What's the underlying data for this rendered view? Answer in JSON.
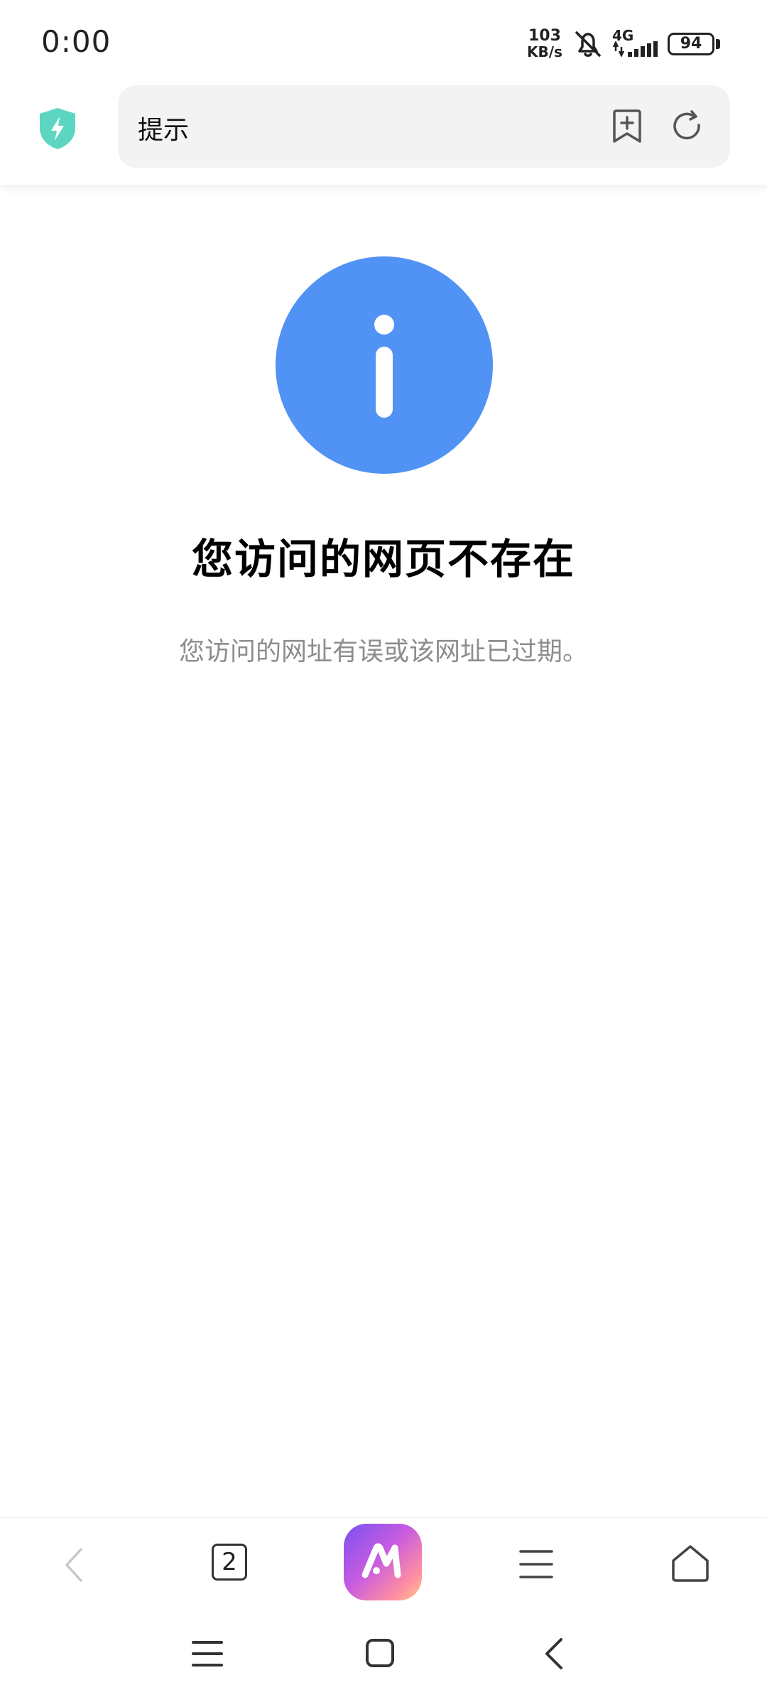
{
  "status_bar": {
    "time": "0:00",
    "speed_value": "103",
    "speed_unit": "KB/s",
    "network_type": "4G",
    "battery_level": "94",
    "icons": [
      "mute-bell-icon",
      "signal-icon",
      "battery-icon"
    ]
  },
  "toolbar": {
    "page_title": "提示",
    "icons": [
      "shield-icon",
      "bookmark-add-icon",
      "reload-icon"
    ]
  },
  "error_page": {
    "icon": "info-icon",
    "title": "您访问的网页不存在",
    "description": "您访问的网址有误或该网址已过期。"
  },
  "bottom_bar": {
    "tab_count": "2",
    "icons": [
      "back-icon",
      "tabs-icon",
      "ai-assistant-icon",
      "menu-icon",
      "home-icon"
    ]
  },
  "system_nav": {
    "icons": [
      "recent-apps-icon",
      "home-square-icon",
      "system-back-icon"
    ]
  },
  "colors": {
    "accent_blue": "#5192f5",
    "shield_teal": "#5cd6c0",
    "desc_gray": "#8d8d8d"
  }
}
